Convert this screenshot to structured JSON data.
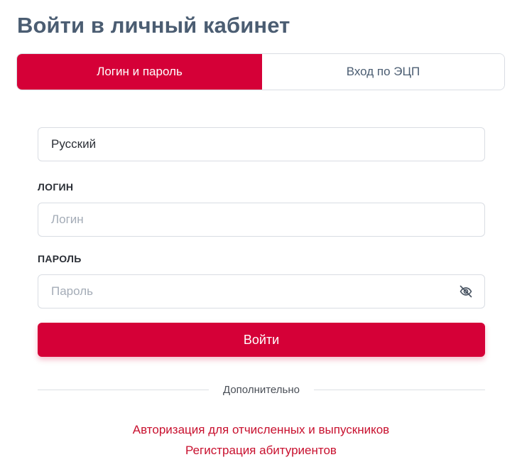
{
  "page": {
    "title": "Войти в личный кабинет"
  },
  "tabs": [
    {
      "label": "Логин и пароль",
      "active": true
    },
    {
      "label": "Вход по ЭЦП",
      "active": false
    }
  ],
  "language": {
    "selected": "Русский"
  },
  "login": {
    "label": "ЛОГИН",
    "placeholder": "Логин",
    "value": ""
  },
  "password": {
    "label": "ПАРОЛЬ",
    "placeholder": "Пароль",
    "value": "",
    "toggle_icon": "eye-off-icon"
  },
  "submit": {
    "label": "Войти"
  },
  "divider": {
    "text": "Дополнительно"
  },
  "links": [
    {
      "label": "Авторизация для отчисленных и выпускников"
    },
    {
      "label": "Регистрация абитуриентов"
    }
  ],
  "colors": {
    "accent": "#d50037",
    "title": "#4b5d72",
    "link": "#c8102e",
    "border": "#d9dde3",
    "placeholder": "#a4acb7"
  }
}
